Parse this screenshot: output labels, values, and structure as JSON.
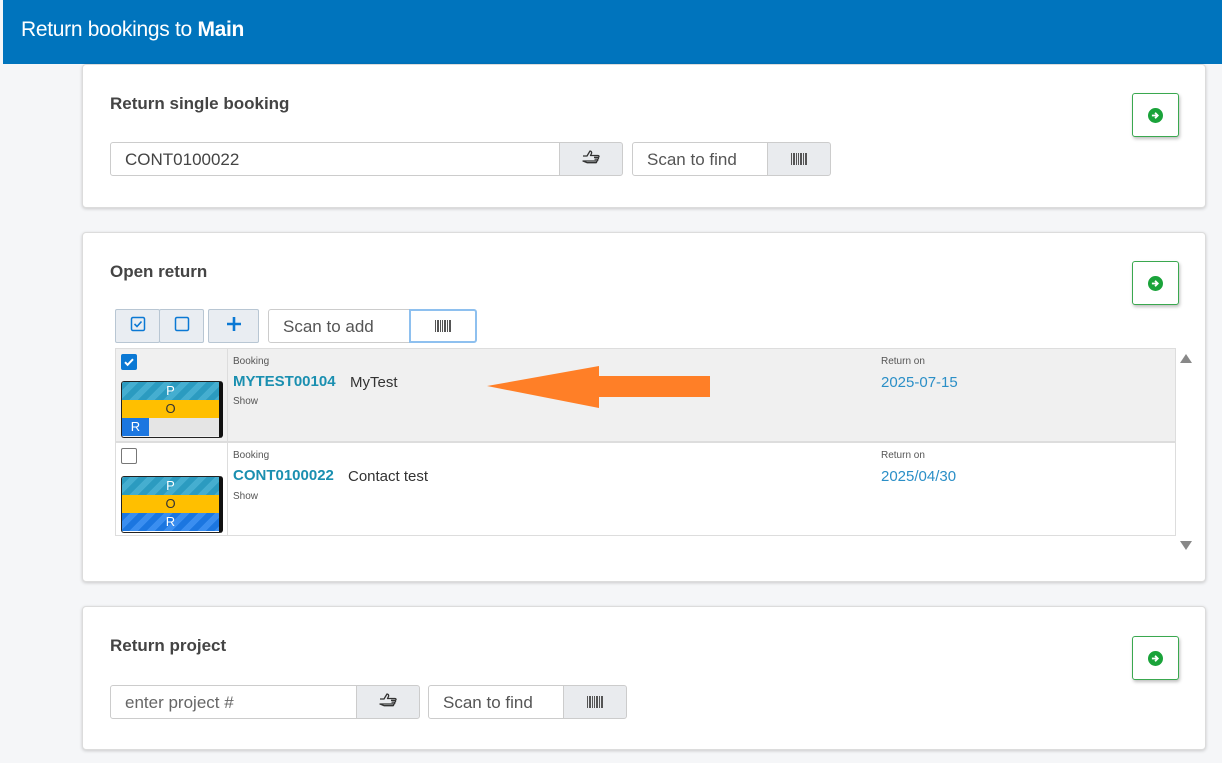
{
  "header": {
    "title_prefix": "Return bookings to",
    "location": "Main"
  },
  "single": {
    "title": "Return single booking",
    "booking_value": "CONT0100022",
    "scan_label": "Scan to find"
  },
  "open_return": {
    "title": "Open return",
    "scan_placeholder": "Scan to add",
    "rows": [
      {
        "checked": true,
        "booking_label": "Booking",
        "code": "MYTEST00104",
        "name": "MyTest",
        "show": "Show",
        "return_label": "Return on",
        "return_date": "2025-07-15",
        "status": {
          "p": "P",
          "o": "O",
          "r": "R"
        }
      },
      {
        "checked": false,
        "booking_label": "Booking",
        "code": "CONT0100022",
        "name": "Contact test",
        "show": "Show",
        "return_label": "Return on",
        "return_date": "2025/04/30",
        "status": {
          "p": "P",
          "o": "O",
          "r": "R"
        }
      }
    ]
  },
  "project": {
    "title": "Return project",
    "placeholder": "enter project #",
    "scan_label": "Scan to find"
  },
  "colors": {
    "header": "#0074bd",
    "go_green": "#1aa33a",
    "link": "#1a8fb0",
    "arrow": "#ff7f27",
    "checkbox": "#0a78d4"
  },
  "icons": [
    "go-arrow-icon",
    "hand-point-icon",
    "barcode-icon",
    "check-all-icon",
    "uncheck-all-icon",
    "plus-icon",
    "scroll-up-icon",
    "scroll-down-icon"
  ]
}
